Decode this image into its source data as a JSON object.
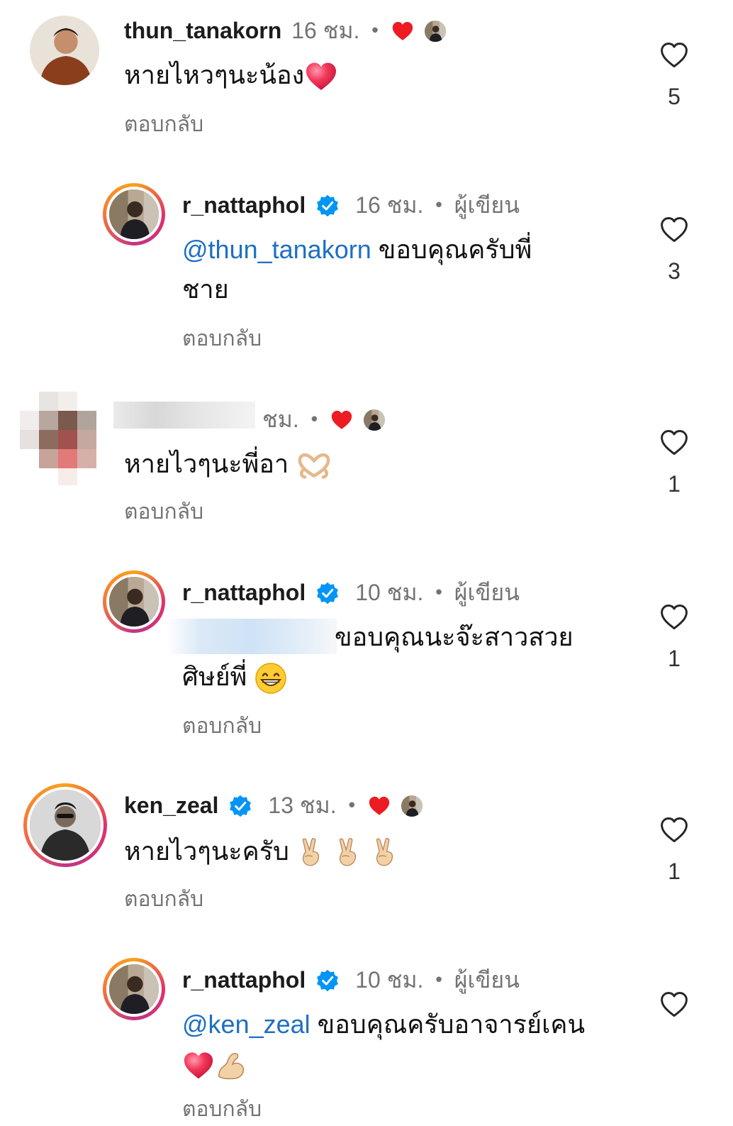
{
  "comments": [
    {
      "username": "thun_tanakorn",
      "time": "16 ชม.",
      "text": "หายไหวๆนะน้อง",
      "reply": "ตอบกลับ",
      "likes": "5"
    },
    {
      "username": "r_nattaphol",
      "time": "16 ชม.",
      "author": "ผู้เขียน",
      "mention": "@thun_tanakorn",
      "text": " ขอบคุณครับพี่",
      "text2": "ชาย",
      "reply": "ตอบกลับ",
      "likes": "3"
    },
    {
      "time": "ชม.",
      "text": "หายไวๆนะพี่อา",
      "reply": "ตอบกลับ",
      "likes": "1"
    },
    {
      "username": "r_nattaphol",
      "time": "10 ชม.",
      "author": "ผู้เขียน",
      "text": "ขอบคุณนะจ๊ะสาวสวย",
      "text2": "ศิษย์พี่",
      "reply": "ตอบกลับ",
      "likes": "1"
    },
    {
      "username": "ken_zeal",
      "time": "13 ชม.",
      "text": "หายไวๆนะครับ",
      "reply": "ตอบกลับ",
      "likes": "1"
    },
    {
      "username": "r_nattaphol",
      "time": "10 ชม.",
      "author": "ผู้เขียน",
      "mention": "@ken_zeal",
      "text": " ขอบคุณครับอาจารย์เคน",
      "reply": "ตอบกลับ",
      "likes": ""
    }
  ],
  "separator": "•",
  "colors": {
    "mention": "#1d6fc3",
    "muted": "#737373",
    "verified": "#0095f6",
    "heart": "#ed1c24"
  },
  "icons": [
    "heart-outline-icon",
    "verified-badge-icon",
    "red-heart-icon",
    "peace-hand-icon",
    "heart-hands-icon",
    "grin-emoji-icon",
    "flexed-arm-icon"
  ]
}
